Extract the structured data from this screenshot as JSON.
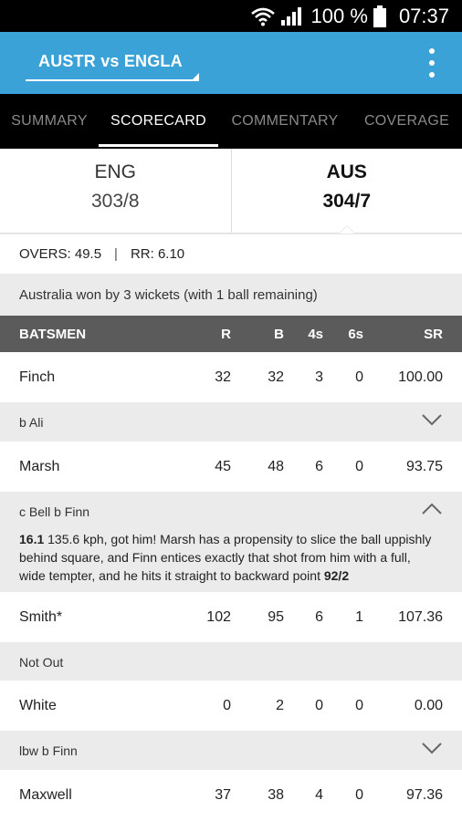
{
  "status_bar": {
    "battery": "100 %",
    "time": "07:37"
  },
  "app_bar": {
    "match_title": "AUSTR vs ENGLA"
  },
  "tabs": [
    {
      "label": "SUMMARY",
      "active": false
    },
    {
      "label": "SCORECARD",
      "active": true
    },
    {
      "label": "COMMENTARY",
      "active": false
    },
    {
      "label": "COVERAGE",
      "active": false
    }
  ],
  "teams": [
    {
      "name": "ENG",
      "score": "303/8",
      "active": false
    },
    {
      "name": "AUS",
      "score": "304/7",
      "active": true
    }
  ],
  "innings": {
    "overs": "OVERS: 49.5",
    "separator": "|",
    "run_rate": "RR: 6.10"
  },
  "result": "Australia won by 3 wickets (with 1 ball remaining)",
  "batsmen_header": {
    "batsmen": "BATSMEN",
    "r": "R",
    "b": "B",
    "fours": "4s",
    "sixes": "6s",
    "sr": "SR"
  },
  "batsmen": [
    {
      "name": "Finch",
      "r": "32",
      "b": "32",
      "fours": "3",
      "sixes": "0",
      "sr": "100.00",
      "dismissal": "b Ali",
      "expanded": false
    },
    {
      "name": "Marsh",
      "r": "45",
      "b": "48",
      "fours": "6",
      "sixes": "0",
      "sr": "93.75",
      "dismissal": "c Bell b Finn",
      "expanded": true,
      "commentary": {
        "over": "16.1",
        "text": " 135.6 kph, got him! Marsh has a propensity to slice the ball uppishly behind square, and Finn entices exactly that shot from him with a full, wide tempter, and he hits it straight to backward point ",
        "score": "92/2"
      }
    },
    {
      "name": "Smith*",
      "r": "102",
      "b": "95",
      "fours": "6",
      "sixes": "1",
      "sr": "107.36",
      "dismissal": "Not Out",
      "expanded": false,
      "no_chevron": true
    },
    {
      "name": "White",
      "r": "0",
      "b": "2",
      "fours": "0",
      "sixes": "0",
      "sr": "0.00",
      "dismissal": "lbw b Finn",
      "expanded": false
    },
    {
      "name": "Maxwell",
      "r": "37",
      "b": "38",
      "fours": "4",
      "sixes": "0",
      "sr": "97.36"
    }
  ],
  "colors": {
    "app_bar": "#3aa2d6",
    "tab_bar": "#000000",
    "header_row": "#5b5b5b",
    "alt_row": "#ebebeb"
  }
}
